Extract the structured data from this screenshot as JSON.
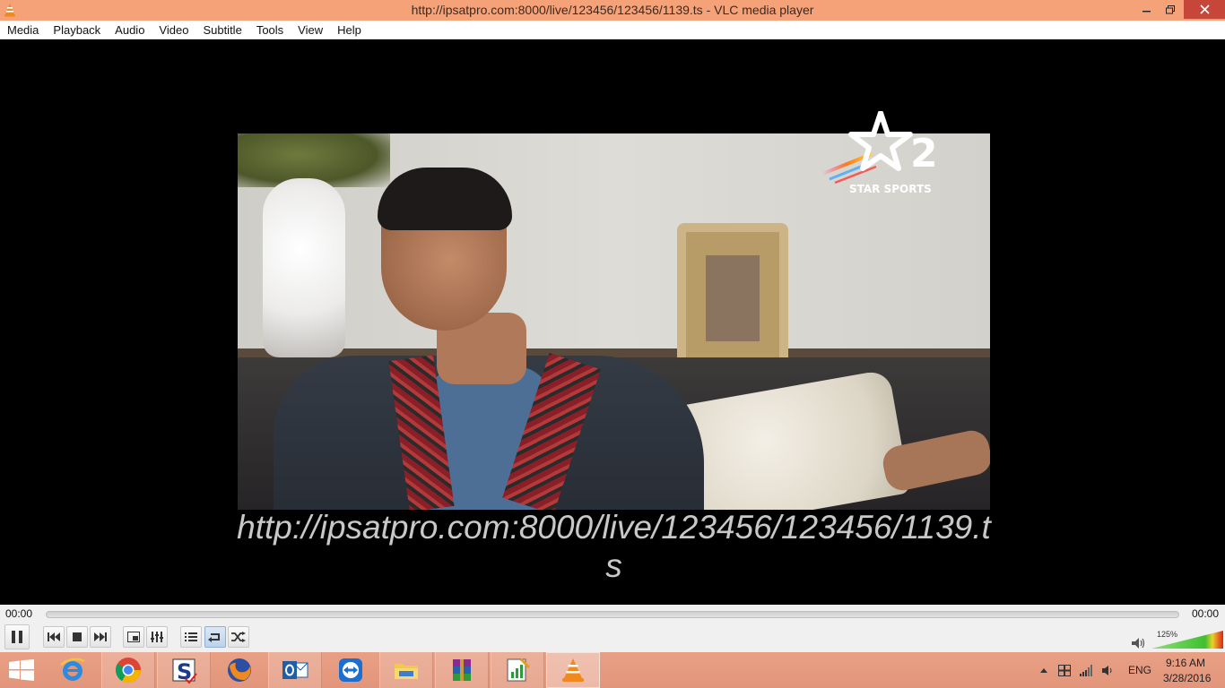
{
  "window": {
    "title": "http://ipsatpro.com:8000/live/123456/123456/1139.ts - VLC media player",
    "icons": {
      "app": "vlc-cone-icon",
      "minimize": "minimize-icon",
      "maximize": "restore-icon",
      "close": "close-icon"
    }
  },
  "menu": {
    "items": [
      "Media",
      "Playback",
      "Audio",
      "Video",
      "Subtitle",
      "Tools",
      "View",
      "Help"
    ]
  },
  "video": {
    "channel_logo_text": "STAR SPORTS",
    "channel_number": "2",
    "overlay_text": "http://ipsatpro.com:8000/live/123456/123456/1139.ts"
  },
  "controls": {
    "time_current": "00:00",
    "time_total": "00:00",
    "seek_progress": 0,
    "buttons": [
      {
        "name": "pause-button",
        "icon": "pause-icon"
      },
      {
        "name": "previous-button",
        "icon": "skip-previous-icon"
      },
      {
        "name": "stop-button",
        "icon": "stop-icon"
      },
      {
        "name": "next-button",
        "icon": "skip-next-icon"
      },
      {
        "name": "fullscreen-button",
        "icon": "fullscreen-icon"
      },
      {
        "name": "extended-settings-button",
        "icon": "equalizer-icon"
      },
      {
        "name": "playlist-button",
        "icon": "playlist-icon"
      },
      {
        "name": "loop-button",
        "icon": "loop-icon"
      },
      {
        "name": "shuffle-button",
        "icon": "shuffle-icon"
      }
    ],
    "volume_label": "125%",
    "volume_level": 1.25,
    "volume_icon": "speaker-icon"
  },
  "taskbar": {
    "apps": [
      {
        "name": "internet-explorer",
        "icon": "internet-explorer-icon"
      },
      {
        "name": "chrome",
        "icon": "chrome-icon"
      },
      {
        "name": "app-s",
        "icon": "s-app-icon"
      },
      {
        "name": "firefox",
        "icon": "firefox-icon"
      },
      {
        "name": "outlook",
        "icon": "outlook-icon"
      },
      {
        "name": "teamviewer",
        "icon": "teamviewer-icon"
      },
      {
        "name": "file-explorer",
        "icon": "folder-icon"
      },
      {
        "name": "winrar",
        "icon": "winrar-icon"
      },
      {
        "name": "notepad-chart",
        "icon": "chart-notepad-icon"
      },
      {
        "name": "vlc",
        "icon": "vlc-cone-icon"
      }
    ],
    "tray": {
      "language": "ENG",
      "time": "9:16 AM",
      "date": "3/28/2016"
    },
    "colors": {
      "taskbar": "#e2957a",
      "titlebar": "#f6a278"
    }
  }
}
